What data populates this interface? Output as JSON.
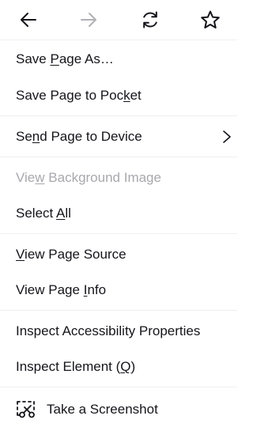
{
  "nav": {
    "back_icon": "back-arrow-icon",
    "forward_icon": "forward-arrow-icon",
    "reload_icon": "reload-icon",
    "bookmark_icon": "star-icon"
  },
  "items": [
    {
      "pre": "Save ",
      "key": "P",
      "post": "age As…"
    },
    {
      "pre": "Save Page to Poc",
      "key": "k",
      "post": "et"
    },
    {
      "pre": "Se",
      "key": "n",
      "post": "d Page to Device"
    },
    {
      "pre": "Vie",
      "key": "w",
      "post": " Background Image"
    },
    {
      "pre": "Select ",
      "key": "A",
      "post": "ll"
    },
    {
      "pre": "",
      "key": "V",
      "post": "iew Page Source"
    },
    {
      "pre": "View Page ",
      "key": "I",
      "post": "nfo"
    },
    {
      "pre": "Inspect Accessibility Properties",
      "key": "",
      "post": ""
    },
    {
      "pre": "Inspect Element (",
      "key": "Q",
      "post": ")"
    },
    {
      "pre": "Take a Screenshot",
      "key": "",
      "post": ""
    }
  ],
  "colors": {
    "text": "#15141a",
    "disabled": "#a8a8ae",
    "forward_disabled": "#b1b1b6",
    "separator": "#f0f0f4"
  }
}
